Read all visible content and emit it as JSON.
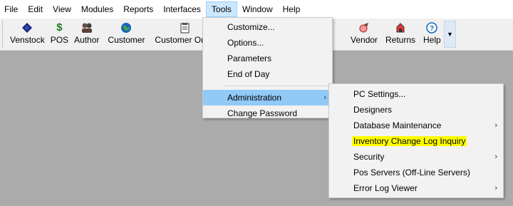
{
  "menubar": {
    "items": [
      "File",
      "Edit",
      "View",
      "Modules",
      "Reports",
      "Interfaces",
      "Tools",
      "Window",
      "Help"
    ],
    "active": "Tools"
  },
  "toolbar": {
    "buttons": [
      {
        "label": "Venstock",
        "icon": "venstock-diamond-icon"
      },
      {
        "label": "POS",
        "icon": "dollar-icon"
      },
      {
        "label": "Author",
        "icon": "author-icon"
      },
      {
        "label": "Customer",
        "icon": "globe-icon"
      },
      {
        "label": "Customer Order",
        "icon": "customer-order-icon"
      },
      {
        "label": "ce",
        "icon": "partial-icon"
      },
      {
        "label": "Vendor",
        "icon": "vendor-icon"
      },
      {
        "label": "Returns",
        "icon": "returns-icon"
      },
      {
        "label": "Help",
        "icon": "help-icon"
      }
    ],
    "overflow_glyph": "▼"
  },
  "tools_menu": {
    "items": [
      "Customize...",
      "Options...",
      "Parameters",
      "End of Day",
      "Administration",
      "Change Password"
    ],
    "highlighted": "Administration"
  },
  "admin_submenu": {
    "items": [
      {
        "label": "PC Settings...",
        "has_submenu": false
      },
      {
        "label": "Designers",
        "has_submenu": false
      },
      {
        "label": "Database Maintenance",
        "has_submenu": true
      },
      {
        "label": "Inventory Change Log Inquiry",
        "has_submenu": false,
        "marked": true
      },
      {
        "label": "Security",
        "has_submenu": true
      },
      {
        "label": "Pos Servers (Off-Line Servers)",
        "has_submenu": false
      },
      {
        "label": "Error Log Viewer",
        "has_submenu": true
      }
    ],
    "arrow_glyph": "›"
  },
  "colors": {
    "menu_highlight": "#91c9f7",
    "active_menu_bg": "#cce8ff",
    "marker": "#ffff00",
    "workspace": "#ababab"
  }
}
